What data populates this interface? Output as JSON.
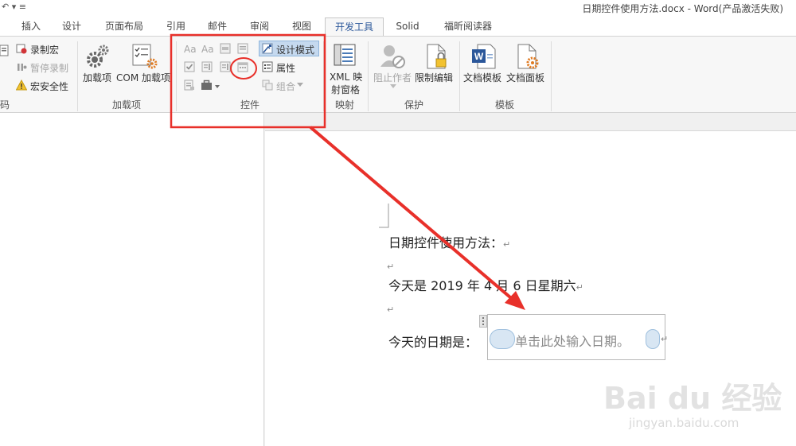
{
  "window": {
    "doc_title": "日期控件使用方法.docx - Word(产品激活失败)",
    "qat_glyph": "↶ ▾  ≡"
  },
  "tabs": [
    {
      "label": "插入",
      "active": false
    },
    {
      "label": "设计",
      "active": false
    },
    {
      "label": "页面布局",
      "active": false
    },
    {
      "label": "引用",
      "active": false
    },
    {
      "label": "邮件",
      "active": false
    },
    {
      "label": "审阅",
      "active": false
    },
    {
      "label": "视图",
      "active": false
    },
    {
      "label": "开发工具",
      "active": true
    },
    {
      "label": "Solid",
      "active": false
    },
    {
      "label": "福昕阅读器",
      "active": false
    }
  ],
  "ribbon": {
    "code_group": {
      "label": "码",
      "record_macro": "录制宏",
      "pause_recording": "暂停录制",
      "macro_security": "宏安全性"
    },
    "addins_group": {
      "label": "加载项",
      "addins_button": "加载项",
      "com_addins_button": "COM 加载项"
    },
    "controls_group": {
      "label": "控件",
      "design_mode": "设计模式",
      "properties": "属性",
      "group": "组合",
      "text_aa": "Aa"
    },
    "mapping_group": {
      "label": "映射",
      "xml_mapping_line1": "XML 映",
      "xml_mapping_line2": "射窗格"
    },
    "protect_group": {
      "label": "保护",
      "block_authors": "阻止作者",
      "restrict_editing": "限制编辑"
    },
    "templates_group": {
      "label": "模板",
      "document_template": "文档模板",
      "document_panel": "文档面板"
    }
  },
  "document": {
    "line1": "日期控件使用方法：",
    "line3": "今天是 2019 年 4 月 6 日星期六",
    "line5_prefix": "今天的日期是：",
    "date_placeholder": "单击此处输入日期。",
    "para_mark": "↵"
  },
  "watermark": {
    "logo": "Bai du 经验",
    "url": "jingyan.baidu.com"
  },
  "colors": {
    "accent": "#2b579a",
    "annotation": "#e8302a",
    "ribbon_bg": "#f7f7f7",
    "selected_button": "#c5d9ef"
  }
}
